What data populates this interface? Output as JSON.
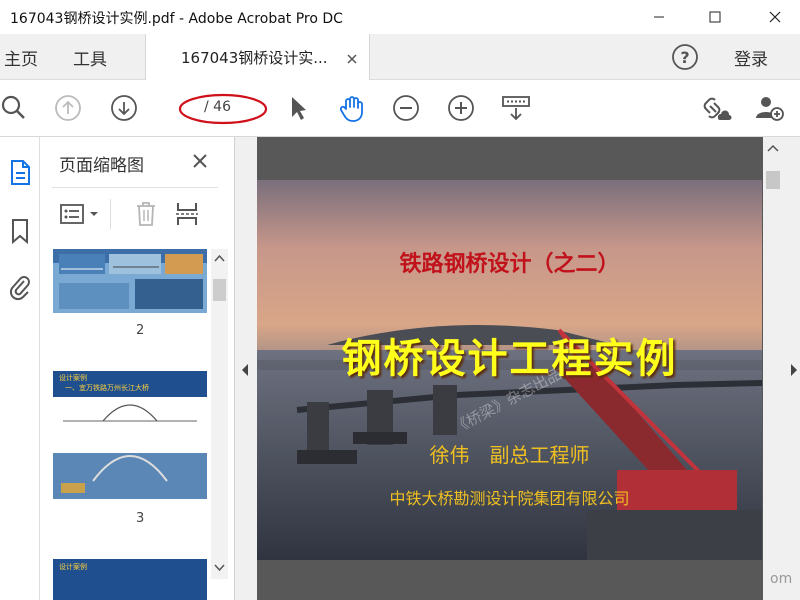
{
  "window": {
    "title": "167043钢桥设计实例.pdf - Adobe Acrobat Pro DC"
  },
  "menubar": {
    "home_label": "主页",
    "tools_label": "工具",
    "doc_tab_label": "167043钢桥设计实...",
    "help_icon": "help-icon",
    "signin_label": "登录"
  },
  "toolbar": {
    "page_number": "",
    "page_total": "/ 46",
    "icons": [
      "zoom-search-icon",
      "page-up-icon",
      "page-down-icon",
      "select-arrow-icon",
      "hand-icon",
      "zoom-out-icon",
      "zoom-in-icon",
      "scroll-mode-icon",
      "share-link-icon",
      "add-user-icon"
    ]
  },
  "left_panel": {
    "title": "页面缩略图",
    "thumbnails": [
      {
        "label": "2"
      },
      {
        "label": "3",
        "caption": "设计案例",
        "heading": "一、宜万铁路万州长江大桥"
      },
      {
        "caption": "设计案例"
      }
    ]
  },
  "slide": {
    "series_title": "铁路钢桥设计（之二）",
    "main_title": "钢桥设计工程实例",
    "author": "徐伟　副总工程师",
    "organization": "中铁大桥勘测设计院集团有限公司",
    "watermark": "《桥梁》杂志出品"
  },
  "corner_watermark": "om",
  "colors": {
    "accent_blue": "#1473e6",
    "annotation_red": "#d0101a",
    "slide_title_yellow": "#ffff1c",
    "slide_series_red": "#c1121c"
  }
}
